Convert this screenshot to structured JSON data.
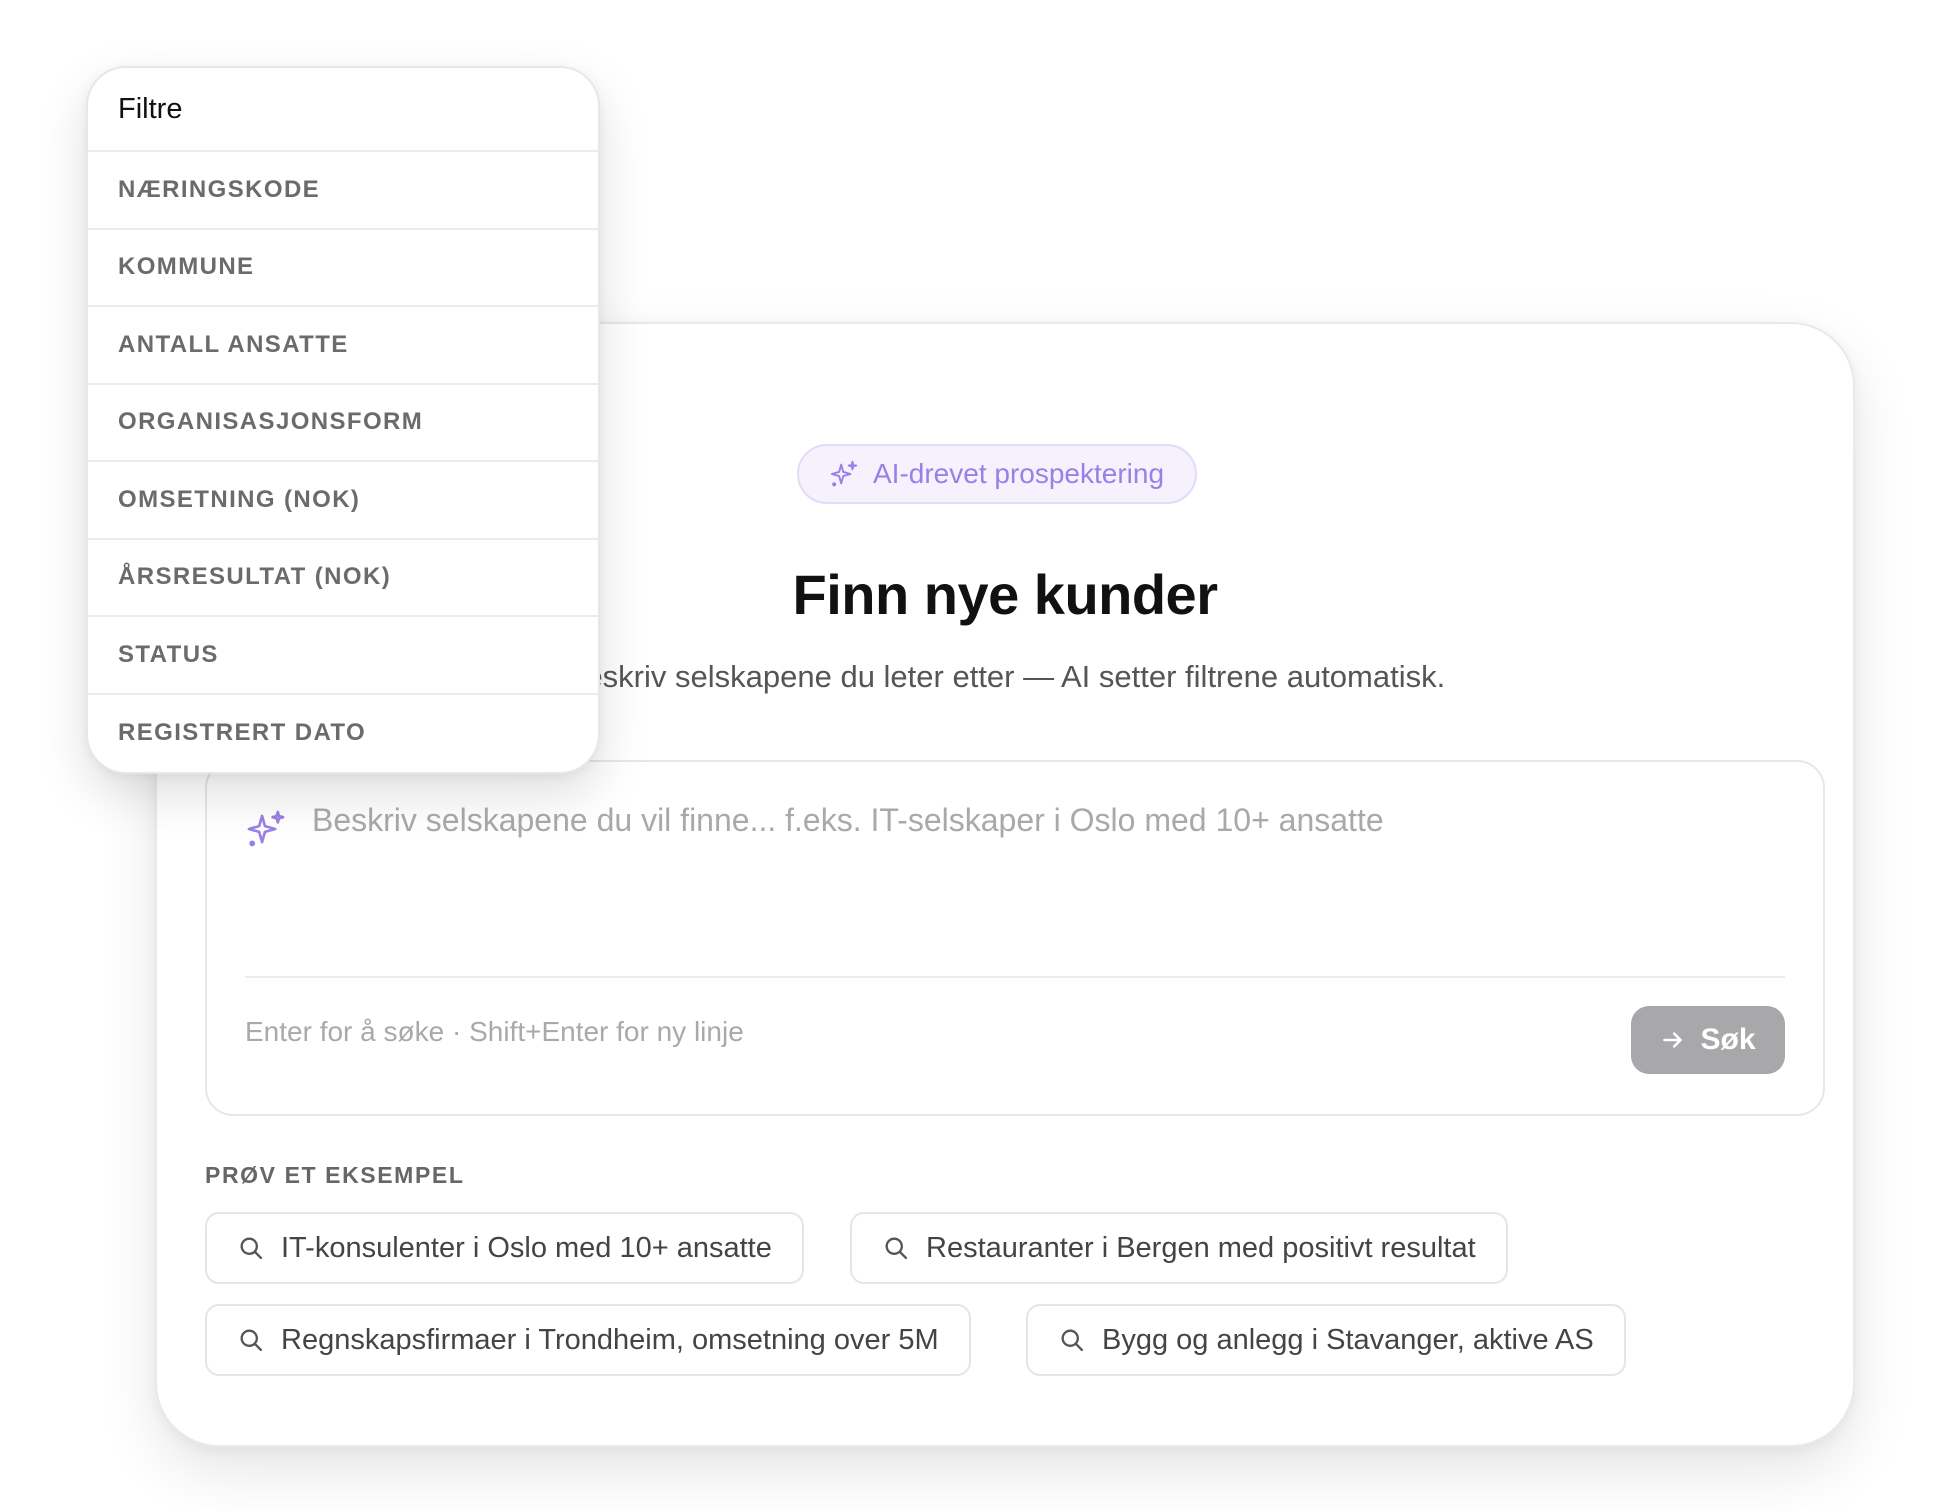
{
  "filters": {
    "title": "Filtre",
    "items": [
      {
        "label": "NÆRINGSKODE"
      },
      {
        "label": "KOMMUNE"
      },
      {
        "label": "ANTALL ANSATTE"
      },
      {
        "label": "ORGANISASJONSFORM"
      },
      {
        "label": "OMSETNING (NOK)"
      },
      {
        "label": "ÅRSRESULTAT (NOK)"
      },
      {
        "label": "STATUS"
      },
      {
        "label": "REGISTRERT DATO"
      }
    ]
  },
  "card": {
    "badge": {
      "label": "AI-drevet prospektering",
      "icon": "sparkle-icon"
    },
    "title": "Finn nye kunder",
    "subtitle": "Beskriv selskapene du leter etter — AI setter filtrene automatisk.",
    "search": {
      "value": "",
      "placeholder": "Beskriv selskapene du vil finne... f.eks. IT-selskaper i Oslo med 10+ ansatte",
      "icon": "sparkle-icon",
      "hint": "Enter for å søke · Shift+Enter for ny linje",
      "button_label": "Søk",
      "button_icon": "arrow-right-icon"
    },
    "examples": {
      "label": "PRØV ET EKSEMPEL",
      "icon": "search-icon",
      "items": [
        {
          "label": "IT-konsulenter i Oslo med 10+ ansatte"
        },
        {
          "label": "Restauranter i Bergen med positivt resultat"
        },
        {
          "label": "Regnskapsfirmaer i Trondheim, omsetning over 5M"
        },
        {
          "label": "Bygg og anlegg i Stavanger, aktive AS"
        }
      ]
    }
  },
  "colors": {
    "accent": "#9b7fe6",
    "badge_bg": "#f5f1fd",
    "button_bg": "#a8a8aa",
    "muted_text": "#a9a9a9"
  }
}
